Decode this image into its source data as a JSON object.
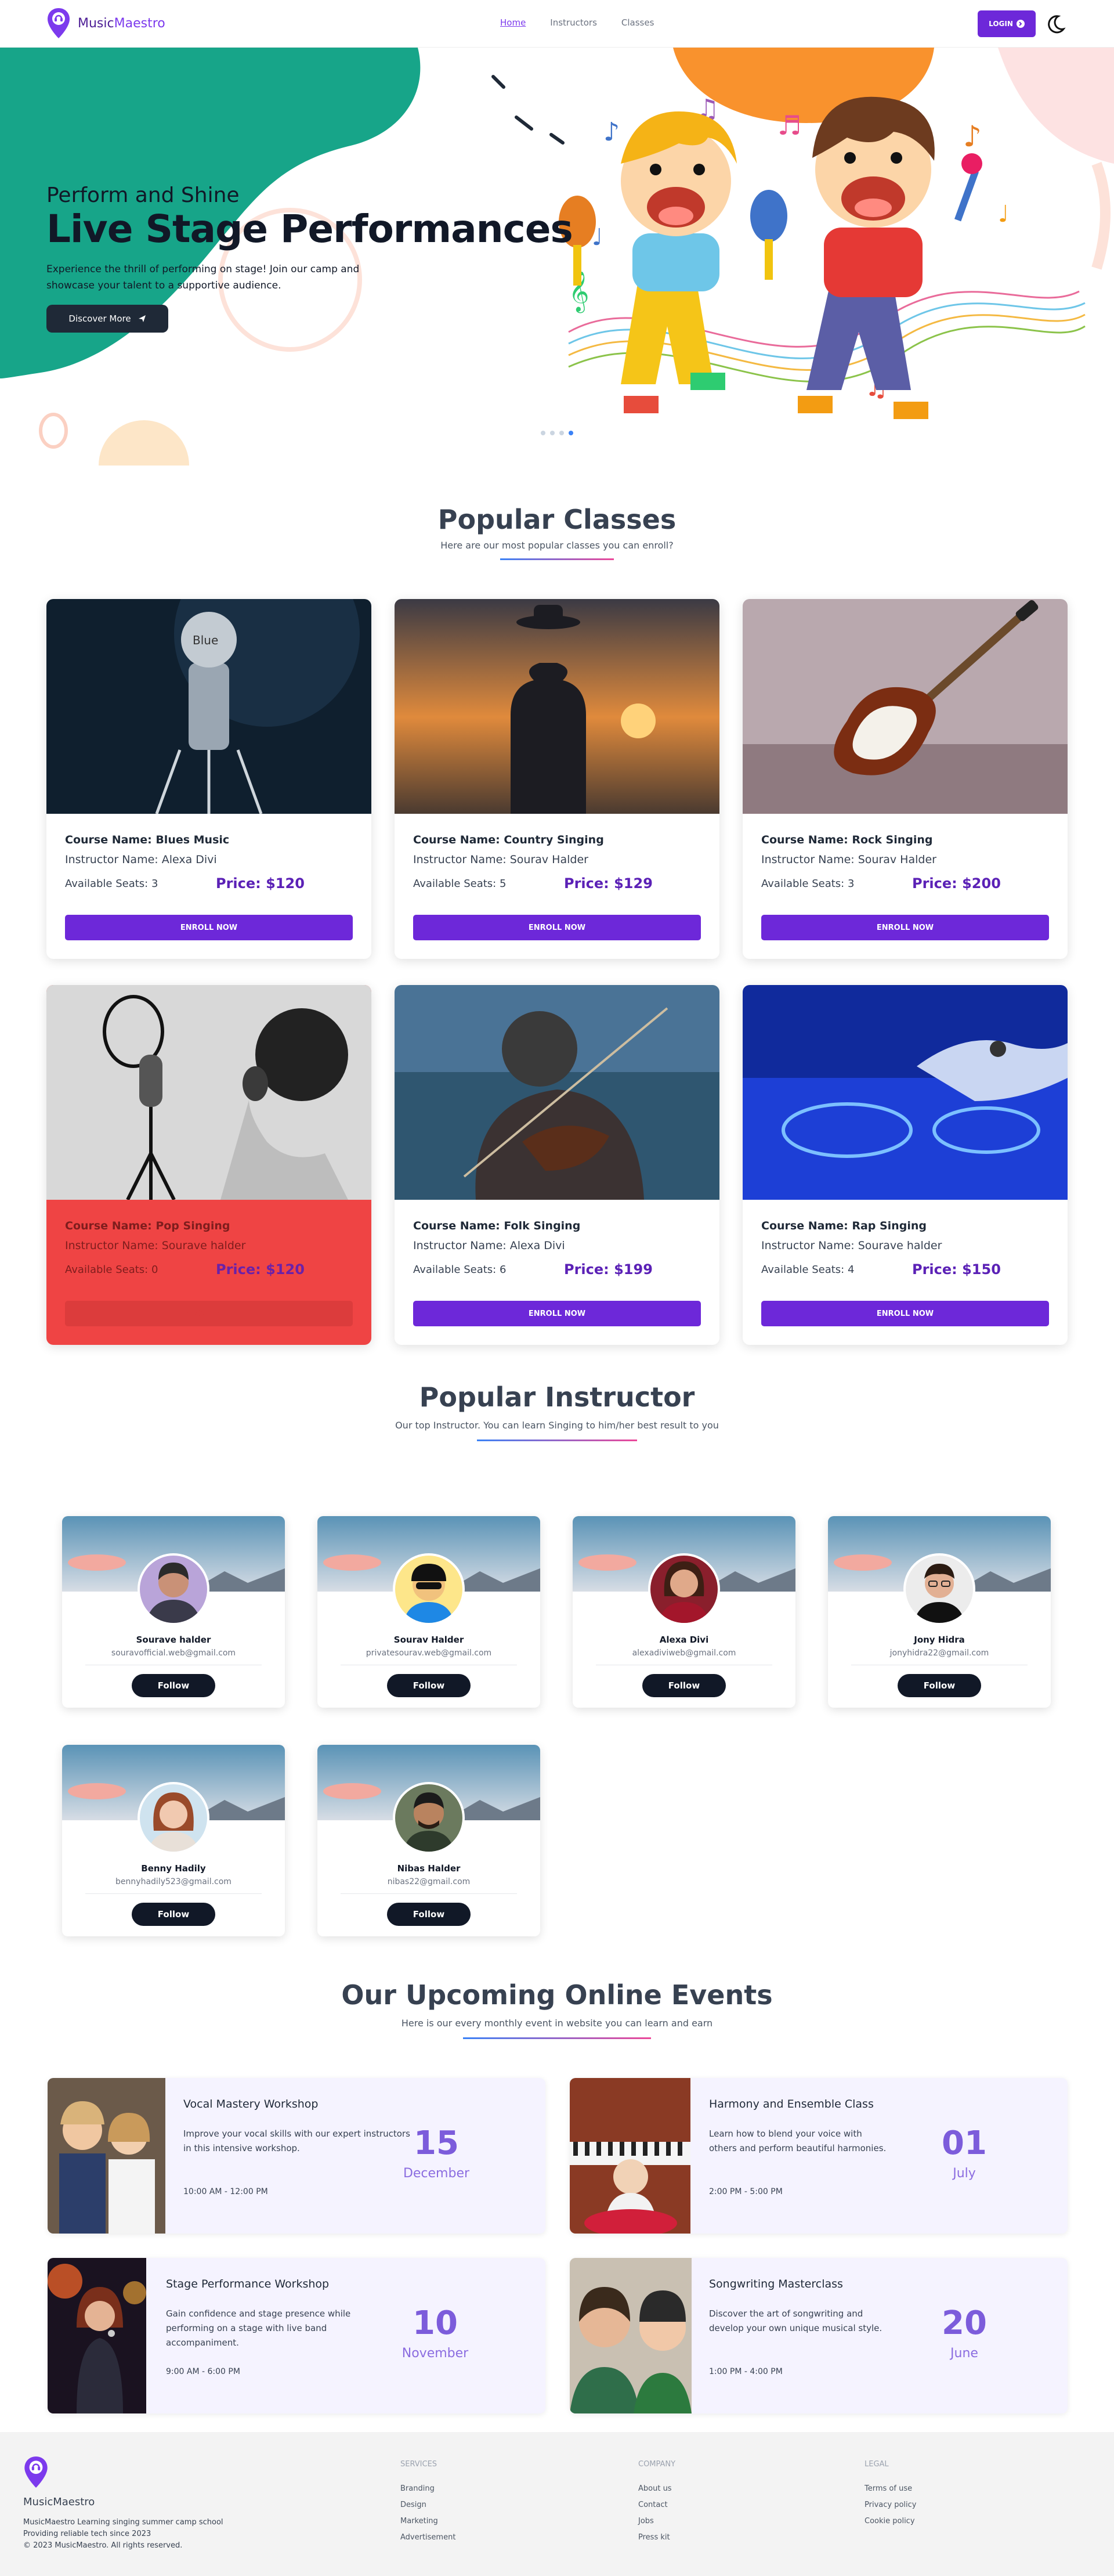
{
  "brand": {
    "name_a": "Music",
    "name_b": "Maestro"
  },
  "nav": {
    "links": [
      "Home",
      "Instructors",
      "Classes"
    ],
    "login": "LOGIN"
  },
  "hero": {
    "kicker": "Perform and Shine",
    "title": "Live Stage Performances",
    "text": "Experience the thrill of performing on stage! Join our camp and showcase your talent to a supportive audience.",
    "button": "Discover More"
  },
  "classes": {
    "title": "Popular Classes",
    "subtitle": "Here are our most popular classes you can enroll?",
    "enroll": "ENROLL NOW",
    "items": [
      {
        "course": "Course Name: Blues Music",
        "instructor": "Instructor Name: Alexa Divi",
        "seats": "Available Seats: 3",
        "price": "Price: $120"
      },
      {
        "course": "Course Name: Country Singing",
        "instructor": "Instructor Name: Sourav Halder",
        "seats": "Available Seats: 5",
        "price": "Price: $129"
      },
      {
        "course": "Course Name: Rock Singing",
        "instructor": "Instructor Name: Sourav Halder",
        "seats": "Available Seats: 3",
        "price": "Price: $200"
      },
      {
        "course": "Course Name: Pop Singing",
        "instructor": "Instructor Name: Sourave halder",
        "seats": "Available Seats: 0",
        "price": "Price: $120"
      },
      {
        "course": "Course Name: Folk Singing",
        "instructor": "Instructor Name: Alexa Divi",
        "seats": "Available Seats: 6",
        "price": "Price: $199"
      },
      {
        "course": "Course Name: Rap Singing",
        "instructor": "Instructor Name: Sourave halder",
        "seats": "Available Seats: 4",
        "price": "Price: $150"
      }
    ]
  },
  "instructors": {
    "title": "Popular Instructor",
    "subtitle": "Our top Instructor. You can learn Singing to him/her best result to you",
    "follow": "Follow",
    "items": [
      {
        "name": "Sourave halder",
        "email": "souravofficial.web@gmail.com"
      },
      {
        "name": "Sourav Halder",
        "email": "privatesourav.web@gmail.com"
      },
      {
        "name": "Alexa Divi",
        "email": "alexadiviweb@gmail.com"
      },
      {
        "name": "Jony Hidra",
        "email": "jonyhidra22@gmail.com"
      },
      {
        "name": "Benny Hadily",
        "email": "bennyhadily523@gmail.com"
      },
      {
        "name": "Nibas Halder",
        "email": "nibas22@gmail.com"
      }
    ]
  },
  "events": {
    "title": "Our Upcoming Online Events",
    "subtitle": "Here is our every monthly event in website you can learn and earn",
    "items": [
      {
        "title": "Vocal Mastery Workshop",
        "desc": "Improve your vocal skills with our expert instructors in this intensive workshop.",
        "time": "10:00 AM - 12:00 PM",
        "day": "15",
        "month": "December"
      },
      {
        "title": "Harmony and Ensemble Class",
        "desc": "Learn how to blend your voice with others and perform beautiful harmonies.",
        "time": "2:00 PM - 5:00 PM",
        "day": "01",
        "month": "July"
      },
      {
        "title": "Stage Performance Workshop",
        "desc": "Gain confidence and stage presence while performing on a stage with live band accompaniment.",
        "time": "9:00 AM - 6:00 PM",
        "day": "10",
        "month": "November"
      },
      {
        "title": "Songwriting Masterclass",
        "desc": "Discover the art of songwriting and develop your own unique musical style.",
        "time": "1:00 PM - 4:00 PM",
        "day": "20",
        "month": "June"
      }
    ]
  },
  "footer": {
    "brand": "MusicMaestro",
    "lines": [
      "MusicMaestro Learning singing summer camp school",
      "Providing reliable tech since 2023",
      "© 2023 MusicMaestro. All rights reserved."
    ],
    "cols": [
      {
        "title": "Services",
        "links": [
          "Branding",
          "Design",
          "Marketing",
          "Advertisement"
        ]
      },
      {
        "title": "Company",
        "links": [
          "About us",
          "Contact",
          "Jobs",
          "Press kit"
        ]
      },
      {
        "title": "Legal",
        "links": [
          "Terms of use",
          "Privacy policy",
          "Cookie policy"
        ]
      }
    ]
  }
}
